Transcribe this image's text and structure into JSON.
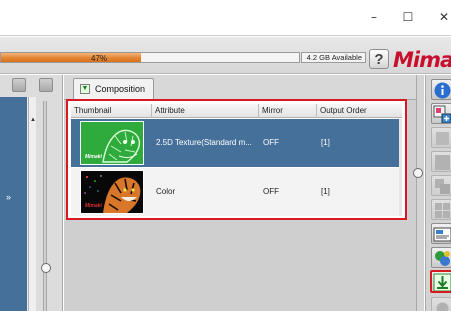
{
  "window": {
    "minimize_glyph": "–",
    "maximize_glyph": "☐",
    "close_glyph": "✕"
  },
  "toolbar": {
    "progress_percent": 47,
    "progress_label": "47%",
    "capacity_label": "4.2 GB Available",
    "help_label": "?",
    "logo_text": "Mimal"
  },
  "left_pane": {
    "chevron_glyph": "»",
    "scroll_arrow_glyph": "▲"
  },
  "composition": {
    "tab_label": "Composition",
    "tab_icon": "down-arrow-icon",
    "columns": [
      "Thumbnail",
      "Attribute",
      "Mirror",
      "Output Order"
    ],
    "rows": [
      {
        "attribute": "2.5D Texture(Standard m...",
        "mirror": "OFF",
        "output_order": "[1]",
        "selected": true,
        "thumb_caption": "Mimaki"
      },
      {
        "attribute": "Color",
        "mirror": "OFF",
        "output_order": "[1]",
        "selected": false,
        "thumb_caption": "Mimaki"
      }
    ]
  },
  "colors": {
    "accent_red": "#d71920",
    "selection_blue": "#44709a",
    "progress_orange": "#e2822f"
  }
}
